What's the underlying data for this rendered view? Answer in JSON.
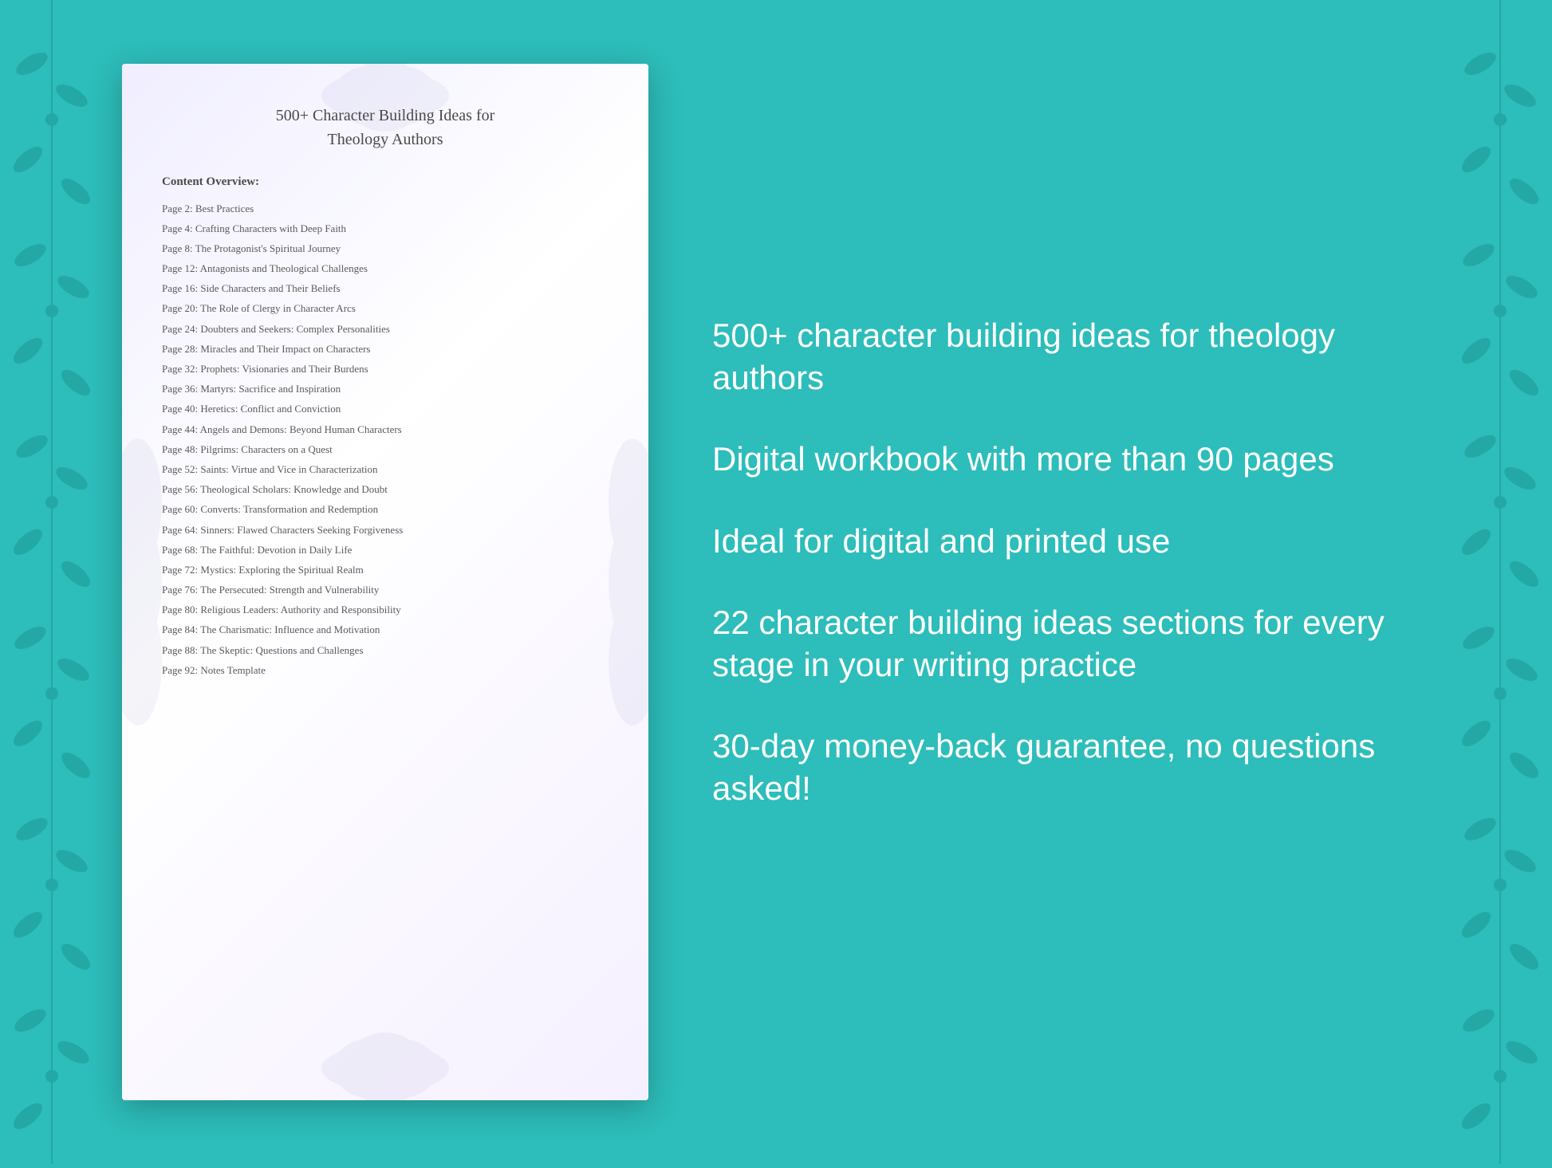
{
  "background": {
    "color": "#2dbdba"
  },
  "document": {
    "title_line1": "500+ Character Building Ideas for",
    "title_line2": "Theology Authors",
    "overview_label": "Content Overview:",
    "toc_items": [
      {
        "page": "Page  2:",
        "title": "Best Practices"
      },
      {
        "page": "Page  4:",
        "title": "Crafting Characters with Deep Faith"
      },
      {
        "page": "Page  8:",
        "title": "The Protagonist's Spiritual Journey"
      },
      {
        "page": "Page 12:",
        "title": "Antagonists and Theological Challenges"
      },
      {
        "page": "Page 16:",
        "title": "Side Characters and Their Beliefs"
      },
      {
        "page": "Page 20:",
        "title": "The Role of Clergy in Character Arcs"
      },
      {
        "page": "Page 24:",
        "title": "Doubters and Seekers: Complex Personalities"
      },
      {
        "page": "Page 28:",
        "title": "Miracles and Their Impact on Characters"
      },
      {
        "page": "Page 32:",
        "title": "Prophets: Visionaries and Their Burdens"
      },
      {
        "page": "Page 36:",
        "title": "Martyrs: Sacrifice and Inspiration"
      },
      {
        "page": "Page 40:",
        "title": "Heretics: Conflict and Conviction"
      },
      {
        "page": "Page 44:",
        "title": "Angels and Demons: Beyond Human Characters"
      },
      {
        "page": "Page 48:",
        "title": "Pilgrims: Characters on a Quest"
      },
      {
        "page": "Page 52:",
        "title": "Saints: Virtue and Vice in Characterization"
      },
      {
        "page": "Page 56:",
        "title": "Theological Scholars: Knowledge and Doubt"
      },
      {
        "page": "Page 60:",
        "title": "Converts: Transformation and Redemption"
      },
      {
        "page": "Page 64:",
        "title": "Sinners: Flawed Characters Seeking Forgiveness"
      },
      {
        "page": "Page 68:",
        "title": "The Faithful: Devotion in Daily Life"
      },
      {
        "page": "Page 72:",
        "title": "Mystics: Exploring the Spiritual Realm"
      },
      {
        "page": "Page 76:",
        "title": "The Persecuted: Strength and Vulnerability"
      },
      {
        "page": "Page 80:",
        "title": "Religious Leaders: Authority and Responsibility"
      },
      {
        "page": "Page 84:",
        "title": "The Charismatic: Influence and Motivation"
      },
      {
        "page": "Page 88:",
        "title": "The Skeptic: Questions and Challenges"
      },
      {
        "page": "Page 92:",
        "title": "Notes Template"
      }
    ]
  },
  "features": [
    {
      "id": "feature-1",
      "text": "500+ character building ideas for theology authors"
    },
    {
      "id": "feature-2",
      "text": "Digital workbook with more than 90 pages"
    },
    {
      "id": "feature-3",
      "text": "Ideal for digital and printed use"
    },
    {
      "id": "feature-4",
      "text": "22 character building ideas sections for every stage in your writing practice"
    },
    {
      "id": "feature-5",
      "text": "30-day money-back guarantee, no questions asked!"
    }
  ]
}
